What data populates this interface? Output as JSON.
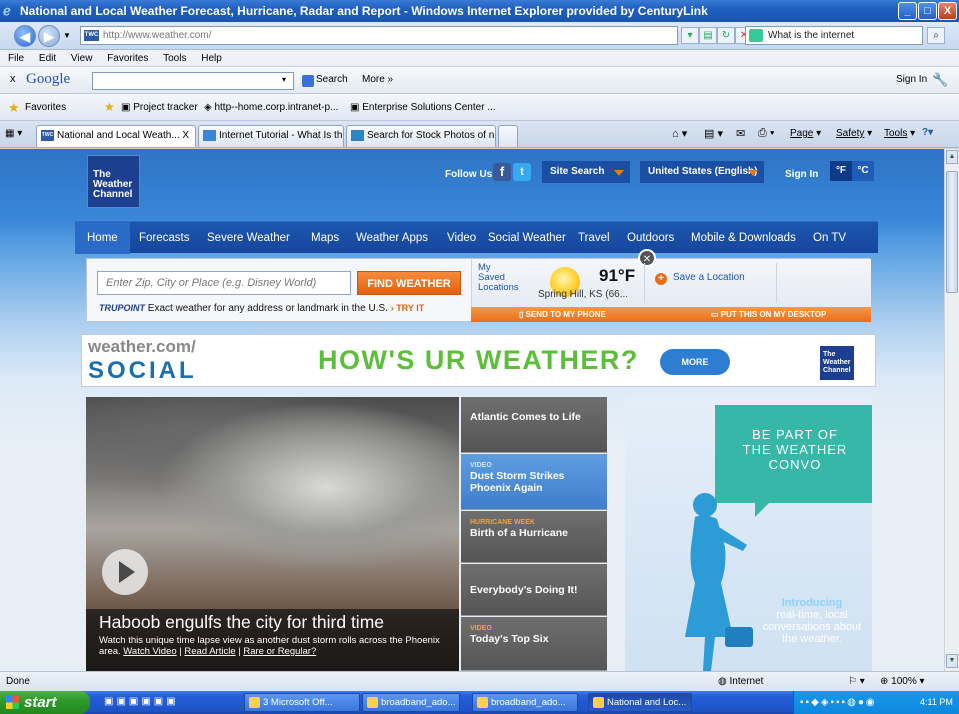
{
  "window": {
    "title": "National and Local Weather Forecast, Hurricane, Radar and Report - Windows Internet Explorer provided by CenturyLink",
    "minimize": "_",
    "maximize": "□",
    "close": "X"
  },
  "addressbar": {
    "url": "http://www.weather.com/",
    "favicon": "TWC",
    "search_text": "What is the internet"
  },
  "menu": {
    "items": [
      "File",
      "Edit",
      "View",
      "Favorites",
      "Tools",
      "Help"
    ]
  },
  "google_toolbar": {
    "close": "x",
    "logo": "Google",
    "search_label": "Search",
    "more_label": "More »",
    "signin_label": "Sign In"
  },
  "favorites_bar": {
    "favorites_label": "Favorites",
    "items": [
      "Project tracker",
      "http--home.corp.intranet-p...",
      "Enterprise Solutions Center ..."
    ]
  },
  "tabs": {
    "items": [
      {
        "label": "National and Local Weath...",
        "close": "X"
      },
      {
        "label": "Internet Tutorial - What Is th..."
      },
      {
        "label": "Search for Stock Photos of n..."
      }
    ],
    "commands": [
      "Page",
      "Safety",
      "Tools"
    ]
  },
  "site": {
    "logo_lines": [
      "The",
      "Weather",
      "Channel"
    ],
    "follow_us": "Follow Us:",
    "facebook": "f",
    "twitter": "t",
    "site_search": "Site Search",
    "region": "United States (English)",
    "signin": "Sign In",
    "unit_f": "°F",
    "unit_c": "°C",
    "nav": [
      "Home",
      "Forecasts",
      "Severe Weather",
      "Maps",
      "Weather Apps",
      "Video",
      "Social Weather",
      "Travel",
      "Outdoors",
      "Mobile & Downloads",
      "On TV"
    ]
  },
  "search": {
    "placeholder": "Enter Zip, City or Place (e.g. Disney World)",
    "button": "FIND WEATHER",
    "trupoint_brand": "TRUPOINT",
    "trupoint_text": "Exact weather for any address or landmark in the U.S.",
    "try_it": "TRY IT",
    "saved_label": [
      "My",
      "Saved",
      "Locations"
    ],
    "temperature": "91°F",
    "location": "Spring Hill, KS (66...",
    "save_location": "Save a Location",
    "send_to_phone": "SEND TO MY PHONE",
    "put_on_desktop": "PUT THIS ON MY DESKTOP"
  },
  "social_banner": {
    "brand_top": "weather.com/",
    "brand_bottom": "SOCIAL",
    "headline": "HOW'S UR WEATHER?",
    "more": "MORE",
    "logo_lines": [
      "The",
      "Weather",
      "Channel"
    ]
  },
  "hero": {
    "headline": "Haboob engulfs the city for third time",
    "subtext": "Watch this unique time lapse view as another dust storm rolls across the Phoenix area.",
    "links": [
      "Watch Video",
      "Read Article",
      "Rare or Regular?"
    ],
    "separator": "|"
  },
  "stories": [
    {
      "tag": "",
      "title": "Atlantic Comes to Life"
    },
    {
      "tag": "VIDEO",
      "title": "Dust Storm Strikes Phoenix Again"
    },
    {
      "tag": "HURRICANE WEEK",
      "title": "Birth of a Hurricane"
    },
    {
      "tag": "",
      "title": "Everybody's Doing It!"
    },
    {
      "tag": "VIDEO",
      "title": "Today's Top Six"
    }
  ],
  "ad": {
    "bubble_lines": [
      "BE PART OF",
      "THE WEATHER",
      "CONVO"
    ],
    "intro_head": "Introducing",
    "intro_body": "real-time, local conversations about the weather."
  },
  "statusbar": {
    "status": "Done",
    "zone": "Internet",
    "zoom": "100%"
  },
  "taskbar": {
    "start": "start",
    "tasks": [
      "3 Microsoft Off...",
      "broadband_ado...",
      "broadband_ado...",
      "National and Loc..."
    ],
    "clock": "4:11 PM"
  }
}
